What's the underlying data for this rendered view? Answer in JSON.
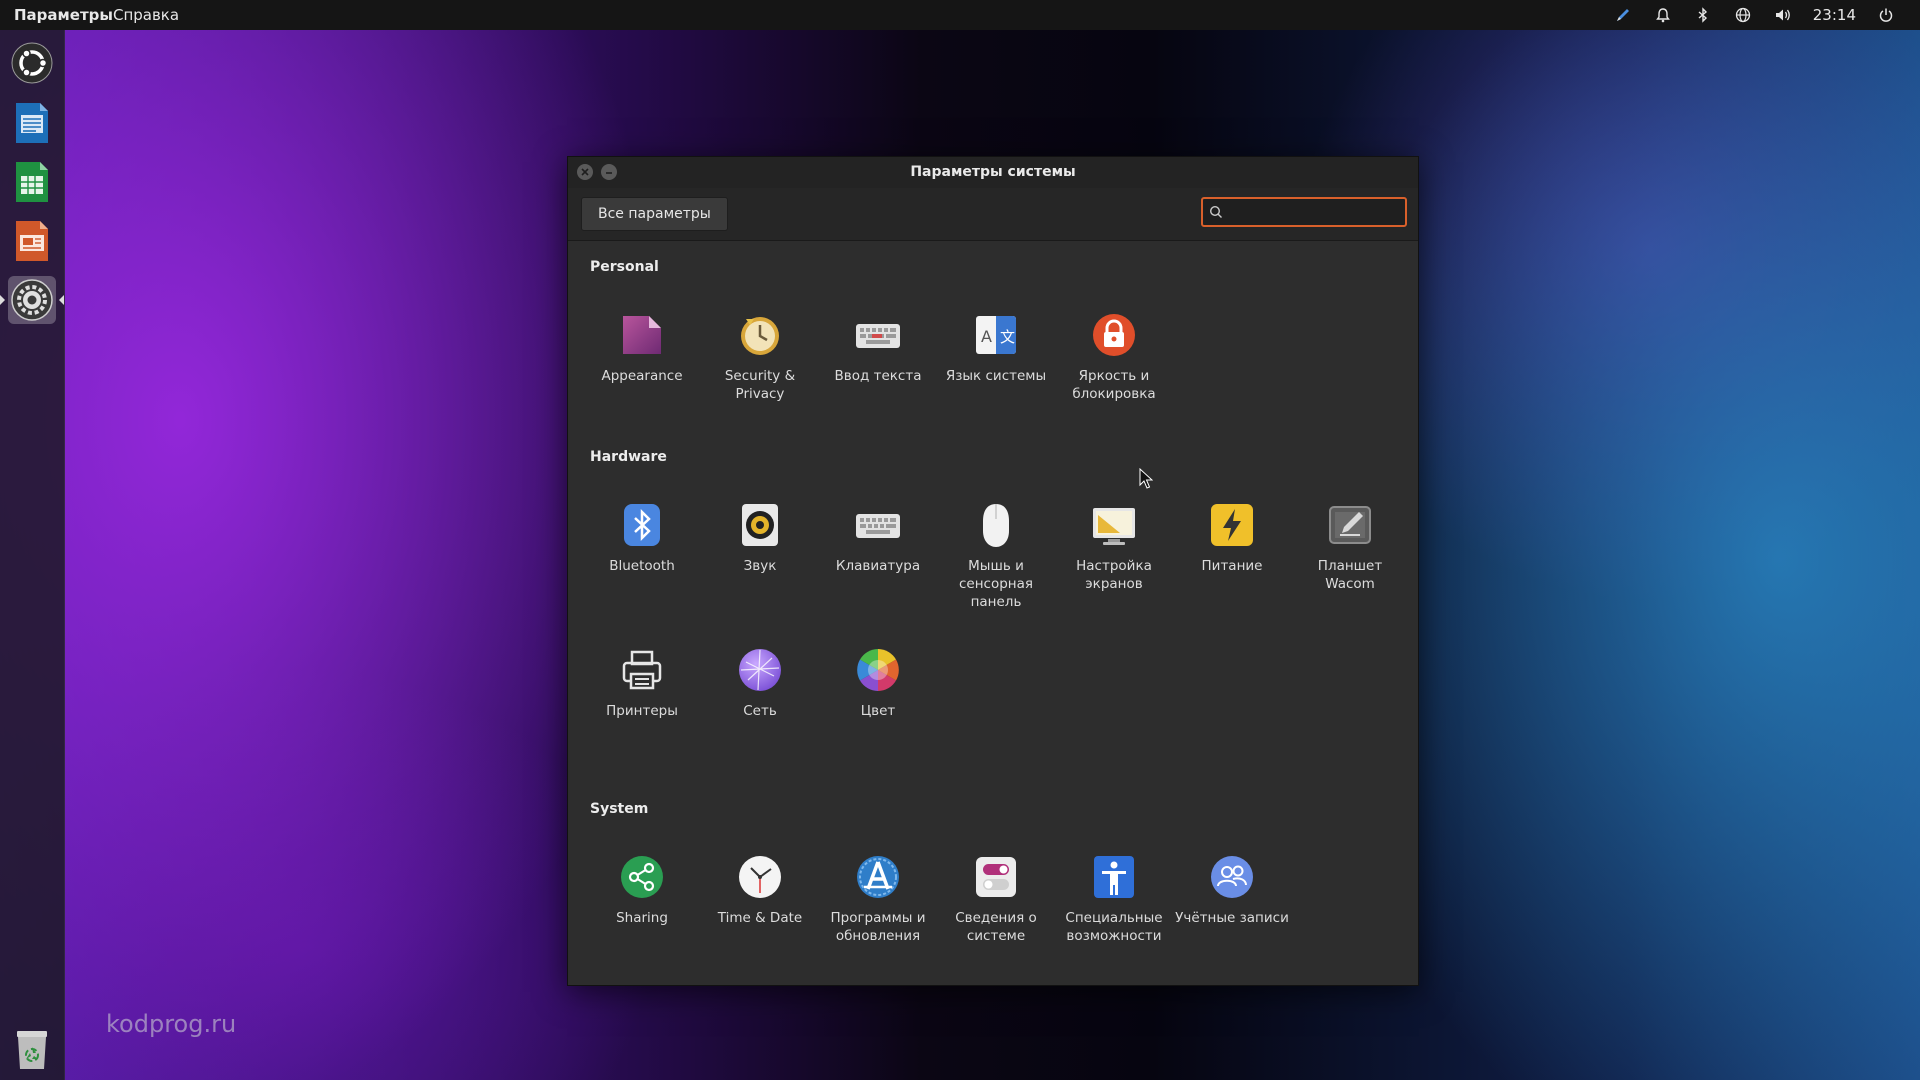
{
  "topbar": {
    "app_menu": "Параметры",
    "help_menu": "Справка",
    "tray_icons": [
      "pen-icon",
      "bell-icon",
      "bluetooth-icon",
      "globe-icon",
      "volume-icon"
    ],
    "clock": "23:14",
    "power_icon": "power-icon"
  },
  "launcher": {
    "items": [
      "ubuntu-dash-icon",
      "writer-icon",
      "calc-icon",
      "impress-icon",
      "settings-icon"
    ],
    "active": "settings-icon",
    "trash": "trash-icon"
  },
  "watermark": "kodprog.ru",
  "window": {
    "title": "Параметры системы",
    "all_settings": "Все параметры",
    "search": {
      "value": "",
      "placeholder": ""
    }
  },
  "sections": [
    {
      "title": "Personal",
      "items": [
        {
          "label": "Appearance",
          "icon": "appearance-icon"
        },
        {
          "label": "Security & Privacy",
          "icon": "security-privacy-icon"
        },
        {
          "label": "Ввод текста",
          "icon": "text-entry-icon"
        },
        {
          "label": "Язык системы",
          "icon": "language-icon"
        },
        {
          "label": "Яркость и блокировка",
          "icon": "brightness-lock-icon"
        }
      ]
    },
    {
      "title": "Hardware",
      "items": [
        {
          "label": "Bluetooth",
          "icon": "bluetooth-icon"
        },
        {
          "label": "Звук",
          "icon": "sound-icon"
        },
        {
          "label": "Клавиатура",
          "icon": "keyboard-icon"
        },
        {
          "label": "Мышь и сенсорная панель",
          "icon": "mouse-icon"
        },
        {
          "label": "Настройка экранов",
          "icon": "displays-icon"
        },
        {
          "label": "Питание",
          "icon": "power-settings-icon"
        },
        {
          "label": "Планшет Wacom",
          "icon": "wacom-icon"
        },
        {
          "label": "Принтеры",
          "icon": "printer-icon"
        },
        {
          "label": "Сеть",
          "icon": "network-icon"
        },
        {
          "label": "Цвет",
          "icon": "color-icon"
        }
      ]
    },
    {
      "title": "System",
      "items": [
        {
          "label": "Sharing",
          "icon": "sharing-icon"
        },
        {
          "label": "Time & Date",
          "icon": "clock-icon"
        },
        {
          "label": "Программы и обновления",
          "icon": "software-updates-icon"
        },
        {
          "label": "Сведения о системе",
          "icon": "system-details-icon"
        },
        {
          "label": "Специальные возможности",
          "icon": "accessibility-icon"
        },
        {
          "label": "Учётные записи",
          "icon": "user-accounts-icon"
        }
      ]
    }
  ]
}
